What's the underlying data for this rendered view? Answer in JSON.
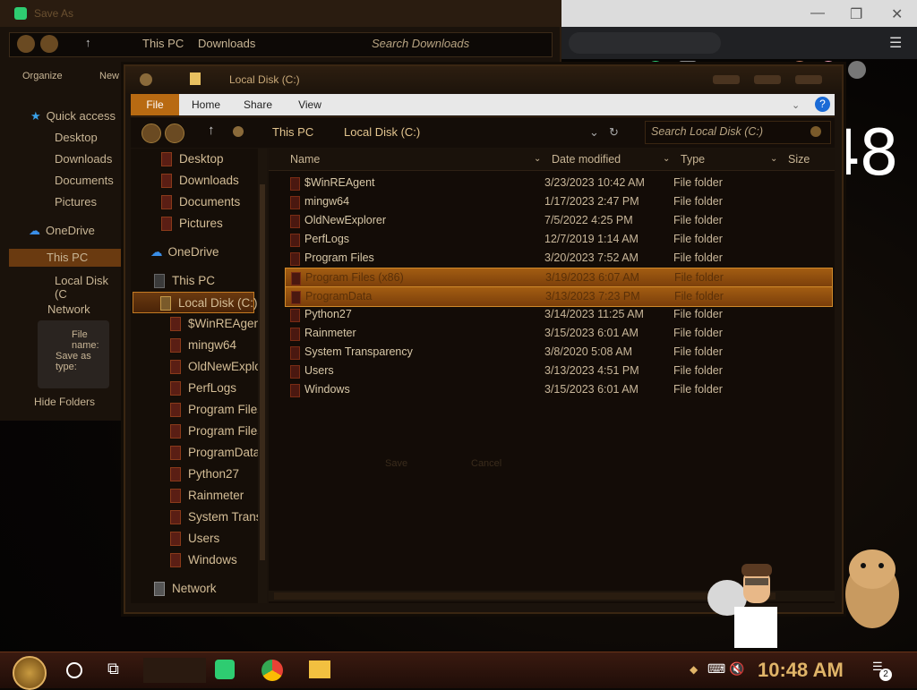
{
  "colors": {
    "accent": "#b86a12",
    "selection": "#a35d12",
    "text": "#d8c8a8",
    "clock": "#e0b468"
  },
  "desktop": {
    "clock": "10:48"
  },
  "saveas": {
    "title": "Save As",
    "address": {
      "crumbs": [
        "This PC",
        "Downloads"
      ],
      "search_placeholder": "Search Downloads"
    },
    "toolbar": {
      "organize": "Organize",
      "new": "New"
    },
    "sidebar": [
      {
        "label": "Quick access",
        "icon": "star-icon"
      },
      {
        "label": "Desktop"
      },
      {
        "label": "Downloads"
      },
      {
        "label": "Documents"
      },
      {
        "label": "Pictures"
      },
      {
        "label": "OneDrive",
        "icon": "cloud-icon"
      },
      {
        "label": "This PC"
      },
      {
        "label": "Local Disk (C"
      },
      {
        "label": "Network"
      }
    ],
    "file_name_label": "File name:",
    "save_type_label": "Save as type:",
    "hide_folders": "Hide Folders",
    "save_label": "Save",
    "cancel_label": "Cancel"
  },
  "explorer": {
    "title": "Local Disk (C:)",
    "ribbon": {
      "tabs": [
        "File",
        "Home",
        "Share",
        "View"
      ]
    },
    "address": {
      "crumbs": [
        "This PC",
        "Local Disk (C:)"
      ],
      "search_placeholder": "Search Local Disk (C:)"
    },
    "nav": [
      {
        "label": "Desktop"
      },
      {
        "label": "Downloads"
      },
      {
        "label": "Documents"
      },
      {
        "label": "Pictures"
      },
      {
        "label": "OneDrive"
      },
      {
        "label": "This PC"
      },
      {
        "label": "Local Disk (C:)"
      },
      {
        "label": "$WinREAgen"
      },
      {
        "label": "mingw64"
      },
      {
        "label": "OldNewExplo"
      },
      {
        "label": "PerfLogs"
      },
      {
        "label": "Program Files"
      },
      {
        "label": "Program Files"
      },
      {
        "label": "ProgramData"
      },
      {
        "label": "Python27"
      },
      {
        "label": "Rainmeter"
      },
      {
        "label": "System Trans"
      },
      {
        "label": "Users"
      },
      {
        "label": "Windows"
      },
      {
        "label": "Network"
      }
    ],
    "columns": {
      "name": "Name",
      "date": "Date modified",
      "type": "Type",
      "size": "Size"
    },
    "rows": [
      {
        "name": "$WinREAgent",
        "date": "3/23/2023 10:42 AM",
        "type": "File folder"
      },
      {
        "name": "mingw64",
        "date": "1/17/2023 2:47 PM",
        "type": "File folder"
      },
      {
        "name": "OldNewExplorer",
        "date": "7/5/2022 4:25 PM",
        "type": "File folder"
      },
      {
        "name": "PerfLogs",
        "date": "12/7/2019 1:14 AM",
        "type": "File folder"
      },
      {
        "name": "Program Files",
        "date": "3/20/2023 7:52 AM",
        "type": "File folder"
      },
      {
        "name": "Program Files (x86)",
        "date": "3/19/2023 6:07 AM",
        "type": "File folder"
      },
      {
        "name": "ProgramData",
        "date": "3/13/2023 7:23 PM",
        "type": "File folder"
      },
      {
        "name": "Python27",
        "date": "3/14/2023 11:25 AM",
        "type": "File folder"
      },
      {
        "name": "Rainmeter",
        "date": "3/15/2023 6:01 AM",
        "type": "File folder"
      },
      {
        "name": "System Transparency",
        "date": "3/8/2020 5:08 AM",
        "type": "File folder"
      },
      {
        "name": "Users",
        "date": "3/13/2023 4:51 PM",
        "type": "File folder"
      },
      {
        "name": "Windows",
        "date": "3/15/2023 6:01 AM",
        "type": "File folder"
      }
    ]
  },
  "taskbar": {
    "time": "10:48 AM",
    "notifications": "2"
  }
}
